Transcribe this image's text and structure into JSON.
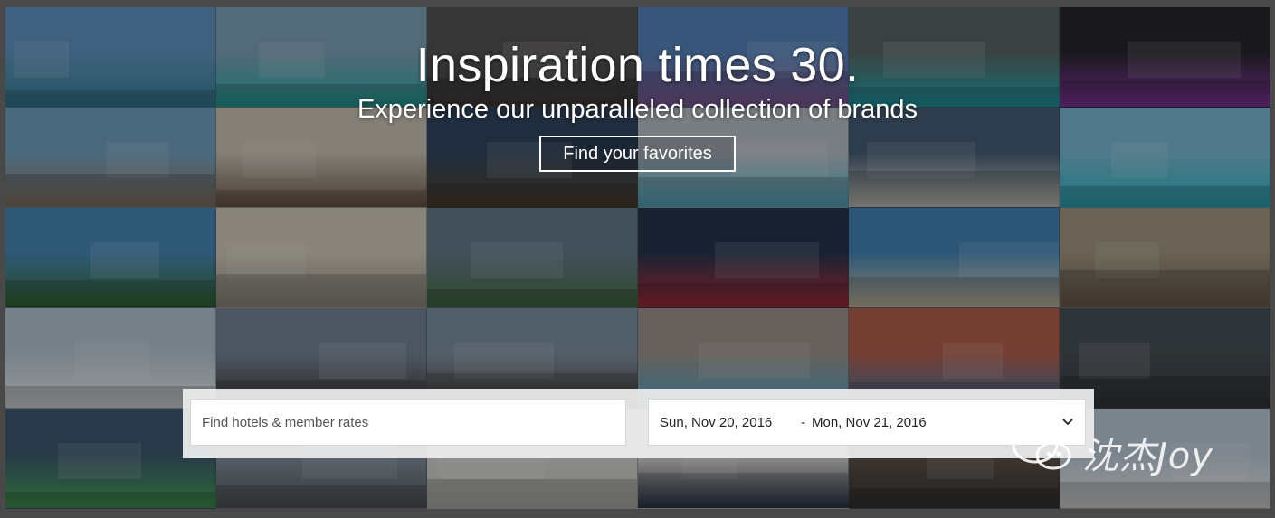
{
  "hero": {
    "title": "Inspiration times 30.",
    "subtitle": "Experience our unparalleled collection of brands",
    "cta_label": "Find your favorites"
  },
  "tiles": [
    {
      "theme": "resort-pool-cabanas",
      "sky": "#5a8fbf",
      "ground": "#2f7e95"
    },
    {
      "theme": "overwater-bungalows-mountain",
      "sky": "#7aa0b7",
      "ground": "#1da8a3"
    },
    {
      "theme": "dim-interior",
      "sky": "#4d4b4b",
      "ground": "#3a3636"
    },
    {
      "theme": "modern-building-blue-sky",
      "sky": "#4e7fb9",
      "ground": "#8b5ca3"
    },
    {
      "theme": "infinity-pool-dusk",
      "sky": "#53605e",
      "ground": "#17a4b3"
    },
    {
      "theme": "w-hotel-sign",
      "sky": "#1b1b22",
      "ground": "#8a2ea8"
    },
    {
      "theme": "beach-deck-pool",
      "sky": "#6d9dbf",
      "ground": "#8a7760"
    },
    {
      "theme": "hotel-room-minimal",
      "sky": "#c8c1b3",
      "ground": "#6a5645"
    },
    {
      "theme": "ring-building-night-boat",
      "sky": "#273d58",
      "ground": "#4a3a26"
    },
    {
      "theme": "indoor-pool-columns",
      "sky": "#b7bfc7",
      "ground": "#4fb4cc"
    },
    {
      "theme": "city-view-bedroom",
      "sky": "#3e5670",
      "ground": "#d9d5cc"
    },
    {
      "theme": "bungalows-lagoon",
      "sky": "#74b8d4",
      "ground": "#22b3c0"
    },
    {
      "theme": "thatched-hut-palms",
      "sky": "#3f83b3",
      "ground": "#2f6a2b"
    },
    {
      "theme": "historic-courtyard",
      "sky": "#cfc8b8",
      "ground": "#9a9186"
    },
    {
      "theme": "glass-villa-hill",
      "sky": "#5f7384",
      "ground": "#3c6b3a"
    },
    {
      "theme": "renaissance-times-square",
      "sky": "#1e2a44",
      "ground": "#b02734"
    },
    {
      "theme": "beach-umbrellas",
      "sky": "#3c7fb4",
      "ground": "#d8c8a6"
    },
    {
      "theme": "stone-facade-arches",
      "sky": "#9d917c",
      "ground": "#6d5b48"
    },
    {
      "theme": "bedroom-blue-chair",
      "sky": "#b4c4d0",
      "ground": "#e7ebef"
    },
    {
      "theme": "four-points-entrance",
      "sky": "#6f7f93",
      "ground": "#3b3430"
    },
    {
      "theme": "rooftop-firepit",
      "sky": "#7a8ca0",
      "ground": "#4a3d34"
    },
    {
      "theme": "pool-loungers-sunset",
      "sky": "#9a8f88",
      "ground": "#4aa2c7"
    },
    {
      "theme": "lounge-red-wall",
      "sky": "#b05a48",
      "ground": "#3a6f9a"
    },
    {
      "theme": "atrium-waterfall",
      "sky": "#40474e",
      "ground": "#2c3033"
    },
    {
      "theme": "green-lounge-seating",
      "sky": "#35506a",
      "ground": "#3c9c4a"
    },
    {
      "theme": "glass-facade-lobby",
      "sky": "#7e8c9a",
      "ground": "#4d5359"
    },
    {
      "theme": "kitchen-white-cabinets",
      "sky": "#d8d8d5",
      "ground": "#bdbdb8"
    },
    {
      "theme": "bedroom-navy-pillows",
      "sky": "#e6e2dc",
      "ground": "#1f2b45"
    },
    {
      "theme": "apartment-kitchen-dark",
      "sky": "#5a4b40",
      "ground": "#2b2b2b"
    },
    {
      "theme": "modern-building-exterior",
      "sky": "#b9c8d7",
      "ground": "#e9e9e9"
    }
  ],
  "search": {
    "placeholder": "Find hotels & member rates",
    "checkin": "Sun, Nov 20, 2016",
    "separator": "-",
    "checkout": "Mon, Nov 21, 2016"
  },
  "watermark": {
    "text": "沈杰Joy"
  },
  "icons": {
    "chevron": "chevron-down-icon",
    "watermark": "wechat-icon"
  }
}
